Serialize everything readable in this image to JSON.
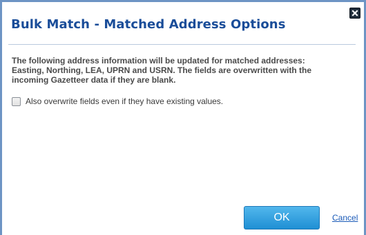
{
  "dialog": {
    "title": "Bulk Match - Matched Address Options",
    "close_icon": "close-icon",
    "message_lines": [
      "The following address information will be updated for matched addresses:",
      "Easting, Northing, LEA, UPRN and USRN. The fields are overwritten with the",
      "incoming Gazetteer data if they are blank."
    ],
    "overwrite_checkbox": {
      "label": "Also overwrite fields even if they have existing values.",
      "checked": false
    },
    "ok_label": "OK",
    "cancel_label": "Cancel"
  },
  "colors": {
    "title": "#1a4d99",
    "border": "#6d94c4",
    "ok_button": "#1f8fd4",
    "link": "#1a5ab8"
  }
}
